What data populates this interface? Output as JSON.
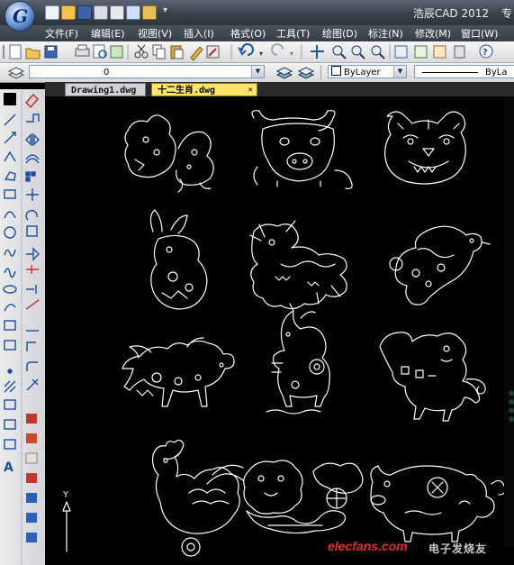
{
  "window": {
    "title": "浩辰CAD 2012",
    "title_overflow": "专"
  },
  "menubar": {
    "items": [
      {
        "label": "文件(F)"
      },
      {
        "label": "编辑(E)"
      },
      {
        "label": "视图(V)"
      },
      {
        "label": "插入(I)"
      },
      {
        "label": "格式(O)"
      },
      {
        "label": "工具(T)"
      },
      {
        "label": "绘图(D)"
      },
      {
        "label": "标注(N)"
      },
      {
        "label": "修改(M)"
      },
      {
        "label": "窗口(W)"
      }
    ]
  },
  "properties_toolbar": {
    "layer_value": "0",
    "color_value": "ByLayer",
    "linetype_value": "ByLa"
  },
  "tabs": [
    {
      "label": "Drawing1.dwg",
      "active": false
    },
    {
      "label": "十二生肖.dwg",
      "active": true
    }
  ],
  "canvas": {
    "background": "#000000",
    "drawing_color": "#ffffff",
    "ucs_y_label": "Y"
  },
  "drawing": {
    "figures": [
      "rat",
      "ox",
      "tiger",
      "rabbit",
      "dragon",
      "snake",
      "horse",
      "goat",
      "monkey",
      "rooster",
      "dog",
      "pig"
    ]
  },
  "watermark": {
    "site": "elecfans.com",
    "label": "电子发烧友"
  },
  "colors": {
    "titlebar": "#3a424c",
    "active_tab": "#ffe66b",
    "watermark": "#e0302a"
  }
}
